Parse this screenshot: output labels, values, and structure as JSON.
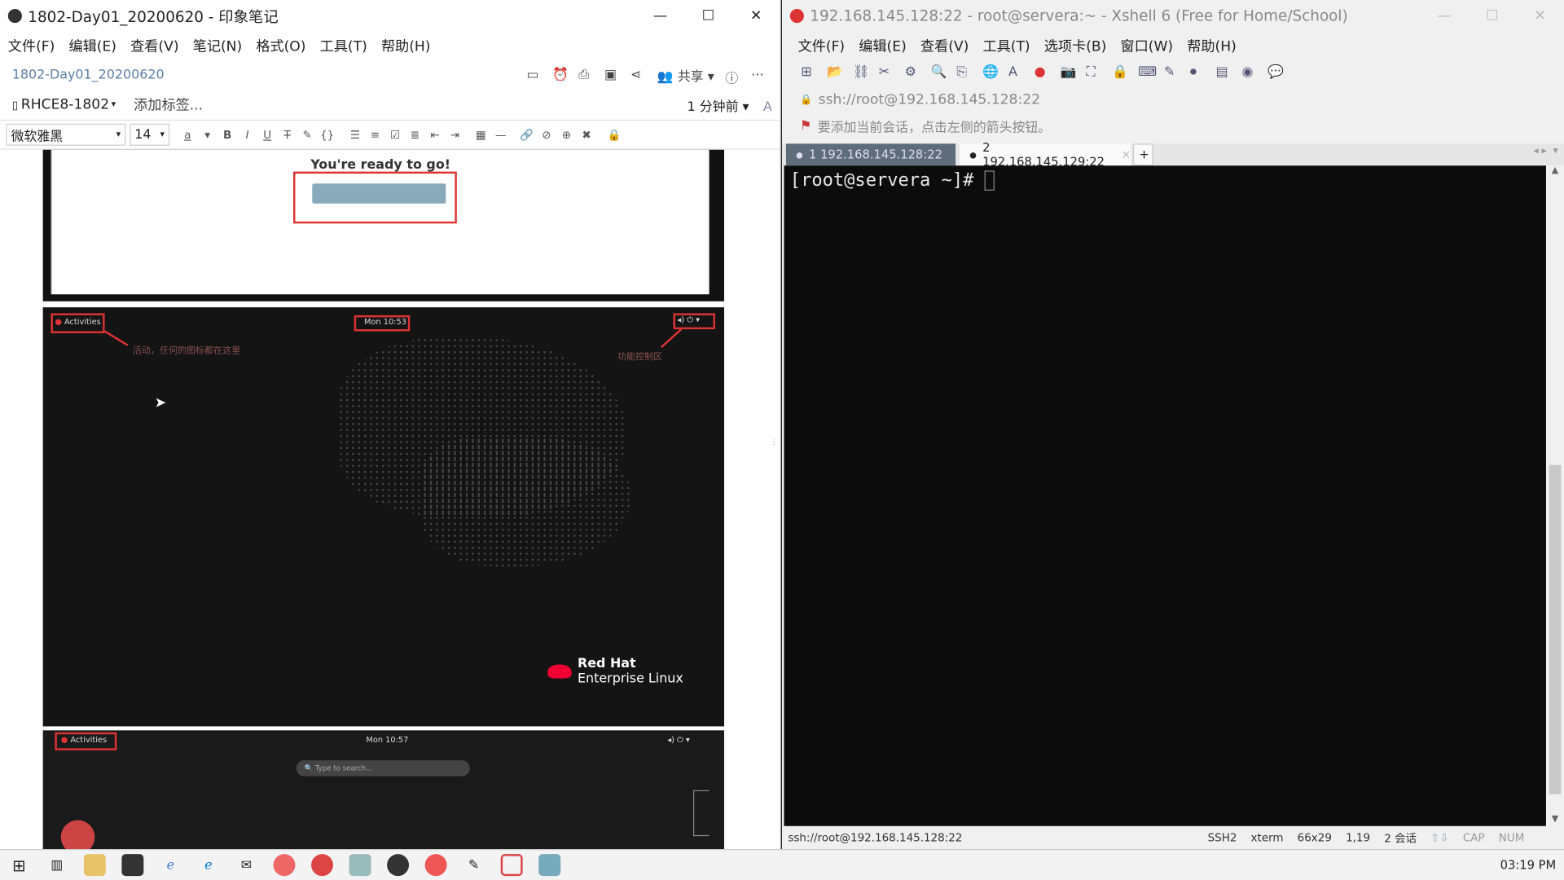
{
  "evernote": {
    "title": "1802-Day01_20200620 - 印象笔记",
    "menu": [
      "文件(F)",
      "编辑(E)",
      "查看(V)",
      "笔记(N)",
      "格式(O)",
      "工具(T)",
      "帮助(H)"
    ],
    "note_title": "1802-Day01_20200620",
    "share_label": "共享",
    "notebook": "RHCE8-1802",
    "add_tag": "添加标签...",
    "updated": "1 分钟前",
    "font_name": "微软雅黑",
    "font_size": "14",
    "content": {
      "ready_text": "You're ready to go!",
      "activities_label": "Activities",
      "clock1": "Mon 10:53",
      "annot_left": "活动，任何的图标都在这里",
      "annot_right": "功能控制区",
      "redhat_line1": "Red Hat",
      "redhat_line2": "Enterprise Linux",
      "activities_label2": "Activities",
      "clock2": "Mon 10:57",
      "search_placeholder": "Type to search..."
    }
  },
  "xshell": {
    "title": "192.168.145.128:22 - root@servera:~ - Xshell 6 (Free for Home/School)",
    "menu": [
      "文件(F)",
      "编辑(E)",
      "查看(V)",
      "工具(T)",
      "选项卡(B)",
      "窗口(W)",
      "帮助(H)"
    ],
    "address": "ssh://root@192.168.145.128:22",
    "hint": "要添加当前会话，点击左侧的箭头按钮。",
    "tabs": [
      "1 192.168.145.128:22",
      "2 192.168.145.129:22"
    ],
    "prompt": "[root@servera ~]# ",
    "status": {
      "connection": "ssh://root@192.168.145.128:22",
      "protocol": "SSH2",
      "term": "xterm",
      "size": "66x29",
      "pos": "1,19",
      "sessions": "2 会话",
      "cap": "CAP",
      "num": "NUM"
    }
  },
  "taskbar": {
    "clock": "03:19 PM"
  },
  "colors": {
    "accent_red": "#dd3333",
    "terminal_bg": "#0c0c0c"
  }
}
